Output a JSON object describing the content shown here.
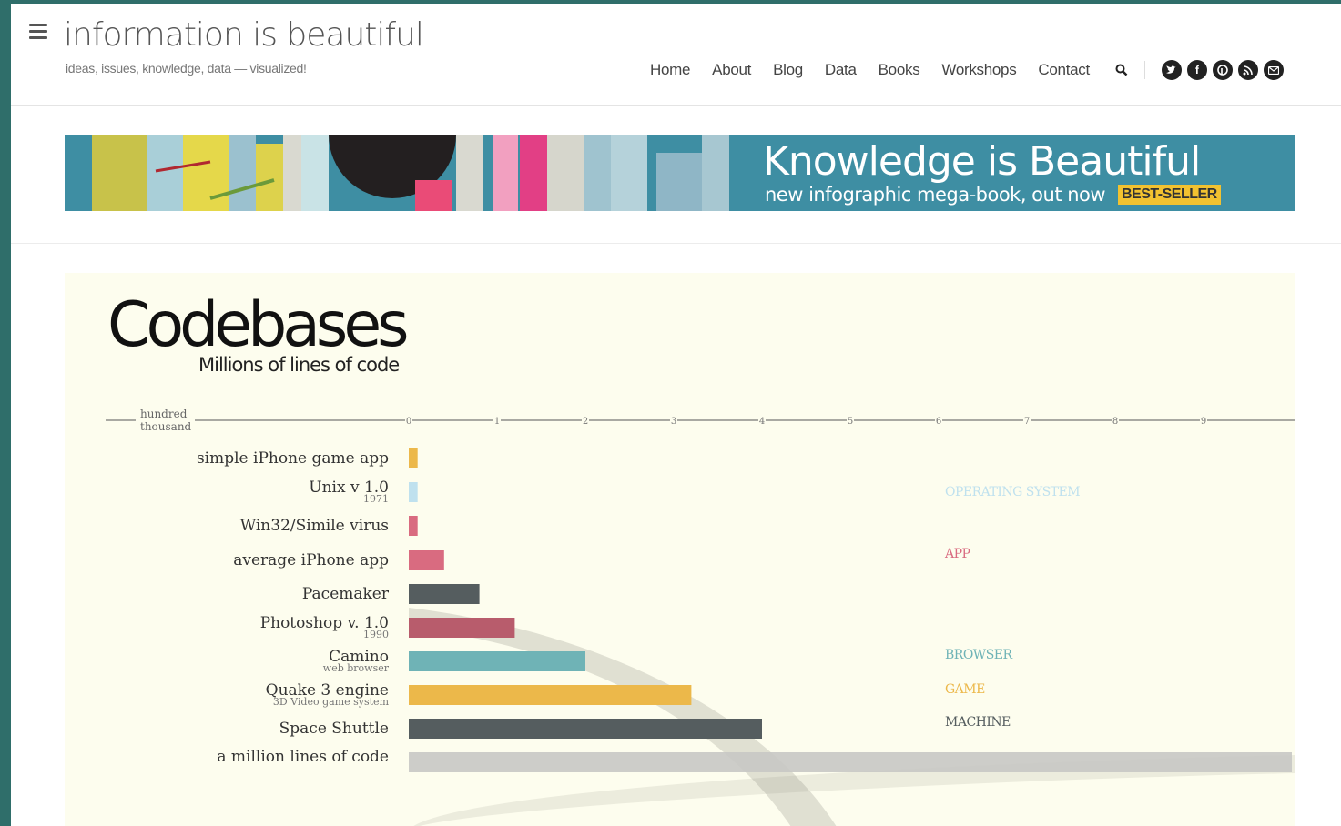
{
  "header": {
    "site_title": "information is beautiful",
    "tagline": "ideas, issues, knowledge, data — visualized!",
    "nav": [
      "Home",
      "About",
      "Blog",
      "Data",
      "Books",
      "Workshops",
      "Contact"
    ],
    "social_icons": [
      "twitter-icon",
      "facebook-icon",
      "pinterest-icon",
      "rss-icon",
      "email-icon"
    ]
  },
  "banner": {
    "title": "Knowledge is Beautiful",
    "subtitle": "new infographic mega-book, out now",
    "badge": "BEST-SELLER"
  },
  "chart": {
    "title": "Codebases",
    "subtitle": "Millions of lines of code"
  },
  "colors": {
    "accent": "#3e8ea3",
    "badge": "#f2c230",
    "panel_bg": "#fdfdee",
    "operating_system": "#bfe1ee",
    "app": "#d96b80",
    "machine": "#555d5f",
    "browser": "#6fb3b6",
    "game": "#ecb84a"
  },
  "chart_data": {
    "type": "bar",
    "title": "Codebases",
    "subtitle": "Millions of lines of code",
    "axis_left_label": [
      "hundred",
      "thousand"
    ],
    "x_ticks": [
      "0",
      "1",
      "2",
      "3",
      "4",
      "5",
      "6",
      "7",
      "8",
      "9"
    ],
    "xlim": [
      0,
      10
    ],
    "bars": [
      {
        "label": "simple iPhone game app",
        "sublabel": "",
        "value": 0.1,
        "category": "game",
        "color": "#ecb84a"
      },
      {
        "label": "Unix v 1.0",
        "sublabel": "1971",
        "value": 0.1,
        "category": "operating system",
        "color": "#bfe1ee"
      },
      {
        "label": "Win32/Simile virus",
        "sublabel": "",
        "value": 0.1,
        "category": "app",
        "color": "#d96b80"
      },
      {
        "label": "average iPhone app",
        "sublabel": "",
        "value": 0.4,
        "category": "app",
        "color": "#d96b80"
      },
      {
        "label": "Pacemaker",
        "sublabel": "",
        "value": 0.8,
        "category": "machine",
        "color": "#555d5f"
      },
      {
        "label": "Photoshop v. 1.0",
        "sublabel": "1990",
        "value": 1.2,
        "category": "app",
        "color": "#b85c6c"
      },
      {
        "label": "Camino",
        "sublabel": "web browser",
        "value": 2.0,
        "category": "browser",
        "color": "#6fb3b6"
      },
      {
        "label": "Quake 3 engine",
        "sublabel": "3D Video game system",
        "value": 3.2,
        "category": "game",
        "color": "#ecb84a"
      },
      {
        "label": "Space Shuttle",
        "sublabel": "",
        "value": 4.0,
        "category": "machine",
        "color": "#555d5f"
      },
      {
        "label": "a million lines of code",
        "sublabel": "",
        "value": 10,
        "category": "reference",
        "color": "#c8c8c4"
      }
    ],
    "legend": [
      {
        "label": "OPERATING SYSTEM",
        "color": "#bfe1ee"
      },
      {
        "label": "APP",
        "color": "#d96b80"
      },
      {
        "label": "BROWSER",
        "color": "#6fb3b6"
      },
      {
        "label": "GAME",
        "color": "#ecb84a"
      },
      {
        "label": "MACHINE",
        "color": "#555d5f"
      }
    ]
  }
}
